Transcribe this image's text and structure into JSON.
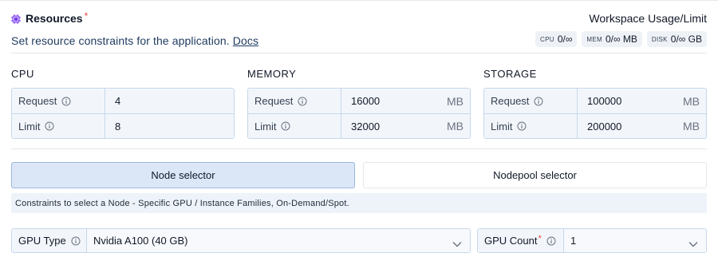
{
  "header": {
    "title": "Resources",
    "required_mark": "*",
    "subtitle": "Set resource constraints for the application.",
    "docs_link": "Docs",
    "usage_title": "Workspace Usage/Limit",
    "badges": [
      {
        "label": "CPU",
        "value": "0/∞"
      },
      {
        "label": "MEM",
        "value": "0/∞ MB"
      },
      {
        "label": "DISK",
        "value": "0/∞ GB"
      }
    ]
  },
  "cpu": {
    "title": "CPU",
    "request_label": "Request",
    "request_value": "4",
    "limit_label": "Limit",
    "limit_value": "8"
  },
  "memory": {
    "title": "MEMORY",
    "request_label": "Request",
    "request_value": "16000",
    "request_unit": "MB",
    "limit_label": "Limit",
    "limit_value": "32000",
    "limit_unit": "MB"
  },
  "storage": {
    "title": "STORAGE",
    "request_label": "Request",
    "request_value": "100000",
    "request_unit": "MB",
    "limit_label": "Limit",
    "limit_value": "200000",
    "limit_unit": "MB"
  },
  "selector": {
    "tabs": [
      {
        "label": "Node selector",
        "active": true
      },
      {
        "label": "Nodepool selector",
        "active": false
      }
    ],
    "hint": "Constraints to select a Node - Specific GPU / Instance Families, On-Demand/Spot."
  },
  "gpu": {
    "type_label": "GPU Type",
    "type_value": "Nvidia A100 (40 GB)",
    "count_label": "GPU Count",
    "count_required": "*",
    "count_value": "1"
  },
  "colors": {
    "accent": "#dbe7f7",
    "border": "#c7d7ea",
    "chip_icon": "#7c3aed",
    "required": "#ef4444"
  }
}
